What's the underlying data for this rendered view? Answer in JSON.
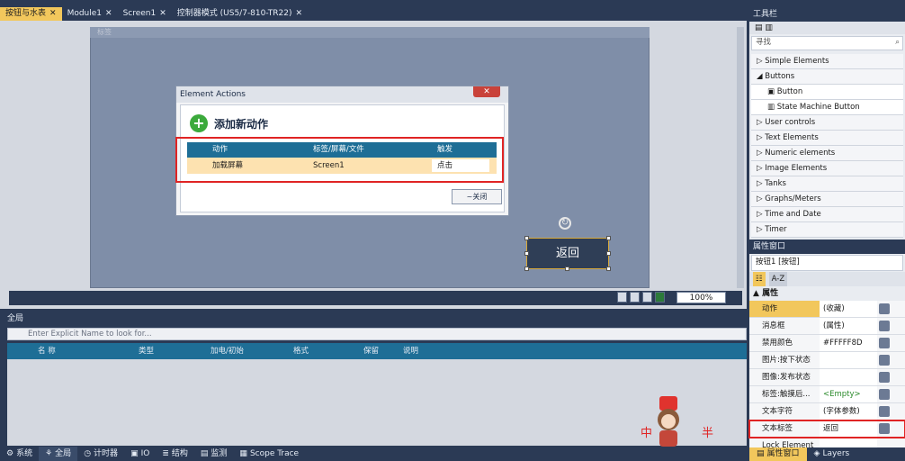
{
  "editor": {
    "tabs": [
      {
        "label": "按钮与水表",
        "active": true
      },
      {
        "label": "Module1",
        "active": false
      },
      {
        "label": "Screen1",
        "active": false
      },
      {
        "label": "控制器模式 (US5/7-810-TR22)",
        "active": false
      }
    ],
    "canvas_header": "标签",
    "zoom": "100%",
    "back_button_label": "返回"
  },
  "dialog": {
    "title": "Element Actions",
    "close_symbol": "✕",
    "add_action_title": "添加新动作",
    "table": {
      "headers": [
        "动作",
        "标签/屏幕/文件",
        "触发"
      ],
      "rows": [
        [
          "加载屏幕",
          "Screen1",
          "点击"
        ]
      ]
    },
    "close_button": "~关闭"
  },
  "global": {
    "title": "全局",
    "search_placeholder": "Enter Explicit Name to look for...",
    "columns": [
      "名 称",
      "类型",
      "加电/初始",
      "格式",
      "保留",
      "说明"
    ]
  },
  "bottom_tabs": [
    "系统",
    "全局",
    "计时器",
    "IO",
    "结构",
    "监测",
    "Scope Trace"
  ],
  "toolbox": {
    "title": "工具栏",
    "search_label": "寻找",
    "items": [
      {
        "label": "Simple Elements",
        "sub": false
      },
      {
        "label": "Buttons",
        "sub": false,
        "expanded": true
      },
      {
        "label": "Button",
        "sub": true
      },
      {
        "label": "State Machine Button",
        "sub": true
      },
      {
        "label": "User controls",
        "sub": false
      },
      {
        "label": "Text Elements",
        "sub": false
      },
      {
        "label": "Numeric elements",
        "sub": false
      },
      {
        "label": "Image Elements",
        "sub": false
      },
      {
        "label": "Tanks",
        "sub": false
      },
      {
        "label": "Graphs/Meters",
        "sub": false
      },
      {
        "label": "Time and Date",
        "sub": false
      },
      {
        "label": "Timer",
        "sub": false
      }
    ]
  },
  "properties": {
    "title": "属性窗口",
    "object": "按钮1 [按钮]",
    "sort_az": "A-Z",
    "category": "属性",
    "rows": [
      {
        "name": "动作",
        "value": "(收藏)"
      },
      {
        "name": "消息框",
        "value": "(属性)"
      },
      {
        "name": "禁用颜色",
        "value": "#FFFFF8D"
      },
      {
        "name": "图片:按下状态",
        "value": ""
      },
      {
        "name": "图像:发布状态",
        "value": ""
      },
      {
        "name": "标签:触摸后...",
        "value": "<Empty>"
      },
      {
        "name": "文本字符",
        "value": "(字体参数)"
      },
      {
        "name": "文本标签",
        "value": "返回"
      },
      {
        "name": "Lock Element",
        "value": ""
      }
    ]
  },
  "right_bottom_tabs": [
    "属性窗口",
    "Layers"
  ],
  "overlay_text": [
    "中",
    "半"
  ],
  "colors": {
    "accent": "#f2c75c",
    "header_blue": "#1e6e96",
    "dark": "#2b3a55",
    "highlight_red": "#e02424"
  }
}
